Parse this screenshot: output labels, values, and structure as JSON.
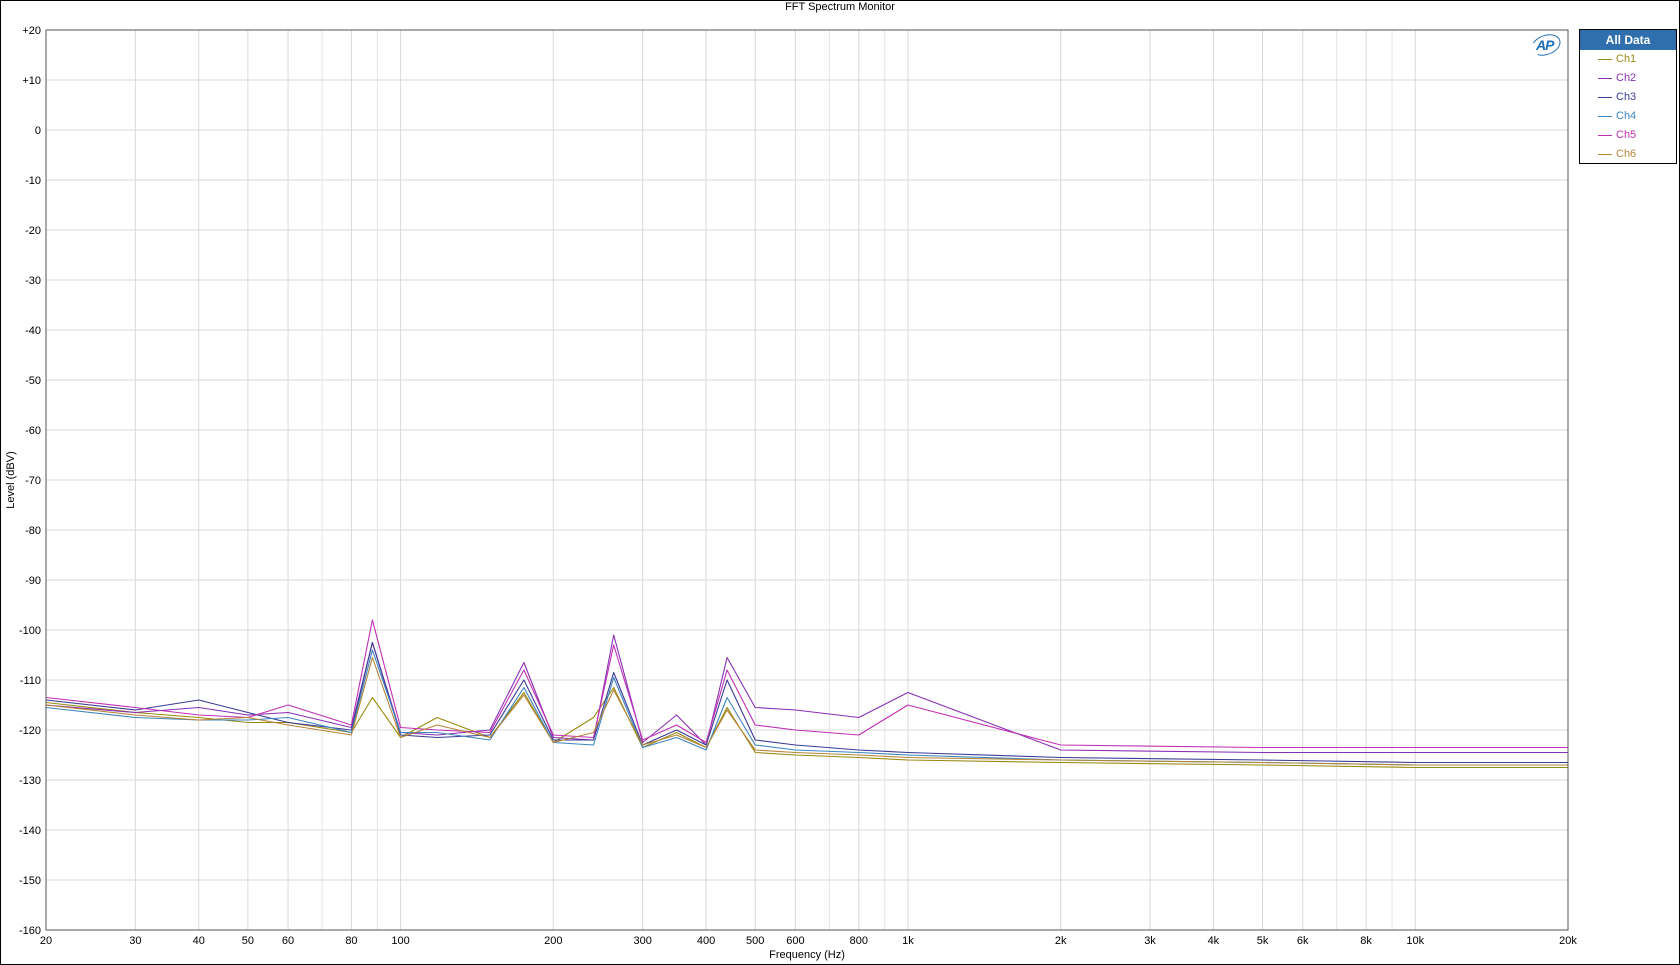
{
  "chart_data": {
    "type": "line",
    "title": "FFT Spectrum Monitor",
    "xlabel": "Frequency (Hz)",
    "ylabel": "Level (dBV)",
    "xscale": "log",
    "xlim": [
      20,
      20000
    ],
    "ylim": [
      -160,
      20
    ],
    "grid": true,
    "legend_position": "top-right",
    "legend_header": "All Data",
    "x_ticks": [
      {
        "value": 20,
        "label": "20"
      },
      {
        "value": 30,
        "label": "30"
      },
      {
        "value": 40,
        "label": "40"
      },
      {
        "value": 50,
        "label": "50"
      },
      {
        "value": 60,
        "label": "60"
      },
      {
        "value": 80,
        "label": "80"
      },
      {
        "value": 100,
        "label": "100"
      },
      {
        "value": 200,
        "label": "200"
      },
      {
        "value": 300,
        "label": "300"
      },
      {
        "value": 400,
        "label": "400"
      },
      {
        "value": 500,
        "label": "500"
      },
      {
        "value": 600,
        "label": "600"
      },
      {
        "value": 800,
        "label": "800"
      },
      {
        "value": 1000,
        "label": "1k"
      },
      {
        "value": 2000,
        "label": "2k"
      },
      {
        "value": 3000,
        "label": "3k"
      },
      {
        "value": 4000,
        "label": "4k"
      },
      {
        "value": 5000,
        "label": "5k"
      },
      {
        "value": 6000,
        "label": "6k"
      },
      {
        "value": 8000,
        "label": "8k"
      },
      {
        "value": 10000,
        "label": "10k"
      },
      {
        "value": 20000,
        "label": "20k"
      }
    ],
    "x_minor_grid": [
      70,
      90,
      700,
      900,
      7000,
      9000
    ],
    "y_ticks": [
      {
        "value": 20,
        "label": "+20"
      },
      {
        "value": 10,
        "label": "+10"
      },
      {
        "value": 0,
        "label": "0"
      },
      {
        "value": -10,
        "label": "-10"
      },
      {
        "value": -20,
        "label": "-20"
      },
      {
        "value": -30,
        "label": "-30"
      },
      {
        "value": -40,
        "label": "-40"
      },
      {
        "value": -50,
        "label": "-50"
      },
      {
        "value": -60,
        "label": "-60"
      },
      {
        "value": -70,
        "label": "-70"
      },
      {
        "value": -80,
        "label": "-80"
      },
      {
        "value": -90,
        "label": "-90"
      },
      {
        "value": -100,
        "label": "-100"
      },
      {
        "value": -110,
        "label": "-110"
      },
      {
        "value": -120,
        "label": "-120"
      },
      {
        "value": -130,
        "label": "-130"
      },
      {
        "value": -140,
        "label": "-140"
      },
      {
        "value": -150,
        "label": "-150"
      },
      {
        "value": -160,
        "label": "-160"
      }
    ],
    "series": [
      {
        "name": "Ch1",
        "color": "#9a8a10",
        "x": [
          20,
          30,
          40,
          50,
          60,
          80,
          88,
          100,
          118,
          150,
          175,
          200,
          240,
          263,
          300,
          350,
          400,
          440,
          500,
          600,
          800,
          1000,
          2000,
          5000,
          10000,
          20000
        ],
        "y": [
          -114.5,
          -116.5,
          -117.5,
          -118.5,
          -118.5,
          -120.5,
          -113.5,
          -121.5,
          -117.5,
          -121.5,
          -112.5,
          -122.5,
          -117.5,
          -111.5,
          -123.5,
          -120.5,
          -123.5,
          -115.5,
          -124.5,
          -125.0,
          -125.5,
          -126.0,
          -126.5,
          -127.0,
          -127.5,
          -127.5
        ]
      },
      {
        "name": "Ch2",
        "color": "#8a2fb5",
        "x": [
          20,
          30,
          40,
          50,
          60,
          80,
          88,
          100,
          118,
          150,
          175,
          200,
          240,
          263,
          300,
          350,
          400,
          440,
          500,
          600,
          800,
          1000,
          2000,
          5000,
          10000,
          20000
        ],
        "y": [
          -115.0,
          -116.5,
          -115.5,
          -117.0,
          -116.5,
          -119.5,
          -102.5,
          -120.5,
          -121.0,
          -120.0,
          -106.5,
          -121.5,
          -122.0,
          -101.0,
          -122.5,
          -117.0,
          -123.0,
          -105.5,
          -115.5,
          -116.0,
          -117.5,
          -112.5,
          -124.0,
          -124.5,
          -124.5,
          -124.5
        ]
      },
      {
        "name": "Ch3",
        "color": "#3b3b96",
        "x": [
          20,
          30,
          40,
          50,
          60,
          80,
          88,
          100,
          118,
          150,
          175,
          200,
          240,
          263,
          300,
          350,
          400,
          440,
          500,
          600,
          800,
          1000,
          2000,
          5000,
          10000,
          20000
        ],
        "y": [
          -114.0,
          -116.0,
          -114.0,
          -116.5,
          -118.5,
          -120.0,
          -102.5,
          -121.0,
          -121.5,
          -121.0,
          -110.0,
          -122.0,
          -122.0,
          -108.5,
          -123.0,
          -120.0,
          -123.0,
          -110.0,
          -122.0,
          -123.0,
          -124.0,
          -124.5,
          -125.5,
          -126.0,
          -126.5,
          -126.5
        ]
      },
      {
        "name": "Ch4",
        "color": "#3d86bf",
        "x": [
          20,
          30,
          40,
          50,
          60,
          80,
          88,
          100,
          118,
          150,
          175,
          200,
          240,
          263,
          300,
          350,
          400,
          440,
          500,
          600,
          800,
          1000,
          2000,
          5000,
          10000,
          20000
        ],
        "y": [
          -115.5,
          -117.5,
          -118.0,
          -118.0,
          -117.5,
          -120.5,
          -104.0,
          -120.5,
          -120.5,
          -122.0,
          -111.5,
          -122.5,
          -123.0,
          -109.5,
          -123.5,
          -121.5,
          -124.0,
          -113.5,
          -123.0,
          -124.0,
          -124.5,
          -125.0,
          -126.0,
          -126.5,
          -127.0,
          -127.0
        ]
      },
      {
        "name": "Ch5",
        "color": "#c22fb5",
        "x": [
          20,
          30,
          40,
          50,
          60,
          80,
          88,
          100,
          118,
          150,
          175,
          200,
          240,
          263,
          300,
          350,
          400,
          440,
          500,
          600,
          800,
          1000,
          2000,
          5000,
          10000,
          20000
        ],
        "y": [
          -113.5,
          -115.5,
          -117.0,
          -117.5,
          -115.0,
          -119.0,
          -98.0,
          -119.5,
          -120.0,
          -120.5,
          -108.0,
          -121.0,
          -121.5,
          -103.0,
          -122.0,
          -119.0,
          -122.5,
          -108.0,
          -119.0,
          -120.0,
          -121.0,
          -115.0,
          -123.0,
          -123.5,
          -123.5,
          -123.5
        ]
      },
      {
        "name": "Ch6",
        "color": "#b5863a",
        "x": [
          20,
          30,
          40,
          50,
          60,
          80,
          88,
          100,
          118,
          150,
          175,
          200,
          240,
          263,
          300,
          350,
          400,
          440,
          500,
          600,
          800,
          1000,
          2000,
          5000,
          10000,
          20000
        ],
        "y": [
          -115.0,
          -117.0,
          -118.0,
          -117.5,
          -119.0,
          -121.0,
          -105.5,
          -121.5,
          -119.0,
          -121.5,
          -113.0,
          -122.5,
          -120.5,
          -112.0,
          -123.0,
          -121.0,
          -123.5,
          -116.0,
          -124.0,
          -124.5,
          -125.0,
          -125.5,
          -126.0,
          -126.5,
          -127.0,
          -127.0
        ]
      }
    ]
  }
}
